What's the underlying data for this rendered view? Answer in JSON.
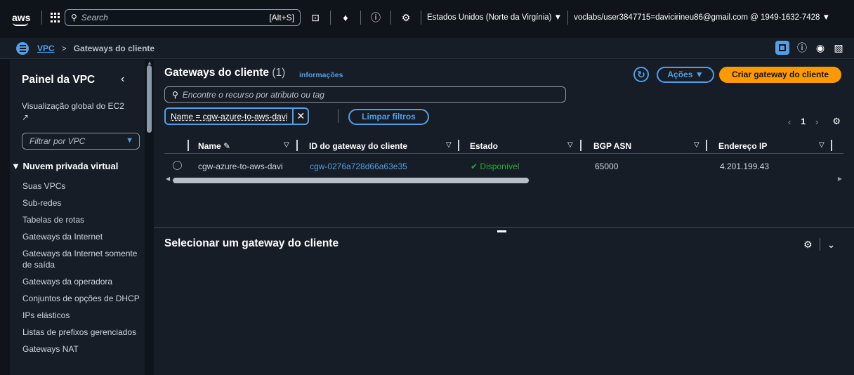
{
  "topbar": {
    "logo": "aws",
    "search_placeholder": "Search",
    "search_shortcut": "[Alt+S]",
    "region": "Estados Unidos (Norte da Virgínia) ▼",
    "account": "voclabs/user3847715=davicirineu86@gmail.com @ 1949-1632-7428 ▼"
  },
  "breadcrumb": {
    "link": "VPC",
    "separator": ">",
    "current": "Gateways do cliente"
  },
  "sidebar": {
    "title": "Painel da VPC",
    "global_view": "Visualização global do EC2",
    "filter_placeholder": "Filtrar por VPC",
    "section": "▼ Nuvem privada virtual",
    "items": [
      "Suas VPCs",
      "Sub-redes",
      "Tabelas de rotas",
      "Gateways da Internet",
      "Gateways da Internet somente de saída",
      "Gateways da operadora",
      "Conjuntos de opções de DHCP",
      "IPs elásticos",
      "Listas de prefixos gerenciados",
      "Gateways NAT"
    ]
  },
  "main": {
    "title": "Gateways do cliente",
    "count": "(1)",
    "info_link": "informações",
    "actions_button": "Ações ▼",
    "create_button": "Criar gateway do cliente",
    "search_placeholder": "Encontre o recurso por atributo ou tag",
    "filter_chip": "Name = cgw-azure-to-aws-davi",
    "clear_filters": "Limpar filtros",
    "page": "1",
    "columns": [
      "Name",
      "ID do gateway do cliente",
      "Estado",
      "BGP ASN",
      "Endereço IP"
    ],
    "rows": [
      {
        "name": "cgw-azure-to-aws-davi",
        "id": "cgw-0276a728d66a63e35",
        "state": "Disponível",
        "bgp_asn": "65000",
        "ip": "4.201.199.43"
      }
    ],
    "detail_title": "Selecionar um gateway do cliente"
  }
}
